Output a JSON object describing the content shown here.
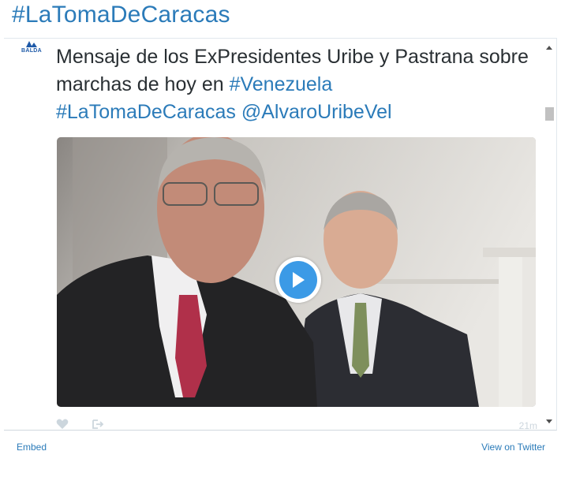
{
  "header": {
    "hashtag_title": "#LaTomaDeCaracas"
  },
  "tweet": {
    "avatar_text": "BALDA",
    "text_plain": "Mensaje de los ExPresidentes Uribe y Pastrana sobre marchas de hoy en ",
    "link_country": "#Venezuela",
    "link_hashtag": "#LaTomaDeCaracas",
    "link_mention": "@AlvaroUribeVel",
    "timestamp": "21m",
    "media_type": "video"
  },
  "footer": {
    "embed_label": "Embed",
    "view_on_twitter_label": "View on Twitter"
  },
  "colors": {
    "link": "#2b7bb9",
    "text": "#292f33",
    "play_button": "#3b9ae6",
    "action_icons": "#ccd6dd"
  }
}
